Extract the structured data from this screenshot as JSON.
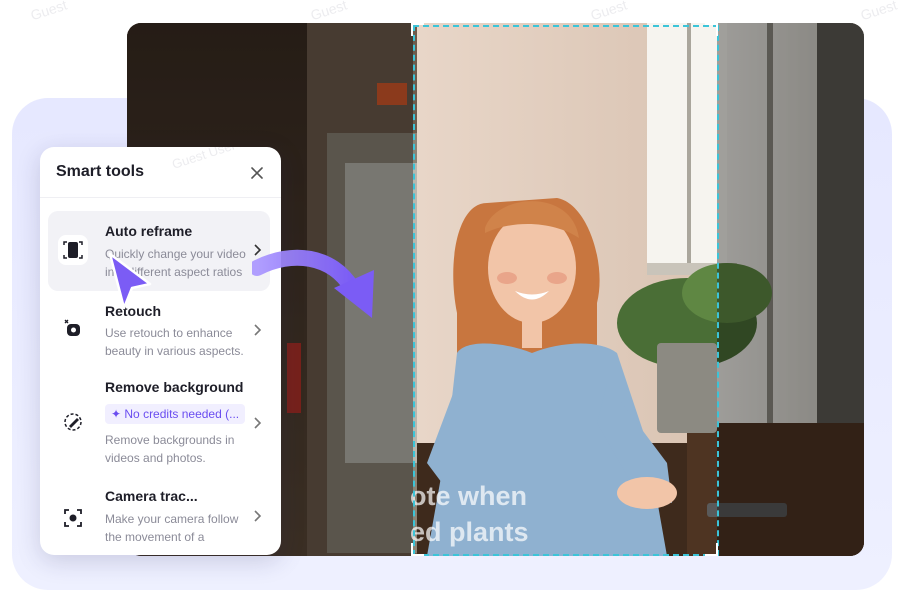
{
  "panel": {
    "title": "Smart tools",
    "tools": [
      {
        "title": "Auto reframe",
        "desc": "Quickly change your video into different aspect ratios ...",
        "icon": "auto-reframe-icon"
      },
      {
        "title": "Retouch",
        "desc": "Use retouch to enhance beauty in various aspects.",
        "icon": "retouch-icon"
      },
      {
        "title": "Remove background",
        "badge": "✦ No credits needed (...",
        "desc": "Remove backgrounds in videos and photos.",
        "icon": "remove-background-icon"
      },
      {
        "title": "Camera trac...",
        "desc": "Make your camera follow the movement of a selected...",
        "icon": "camera-tracking-icon"
      }
    ]
  },
  "caption": {
    "line1": "ote when",
    "line2": "ed plants"
  },
  "watermark": "Guest User 2097",
  "colors": {
    "accent": "#7b5cf5",
    "crop": "#3cc4d8",
    "badge_text": "#6a4df0"
  }
}
